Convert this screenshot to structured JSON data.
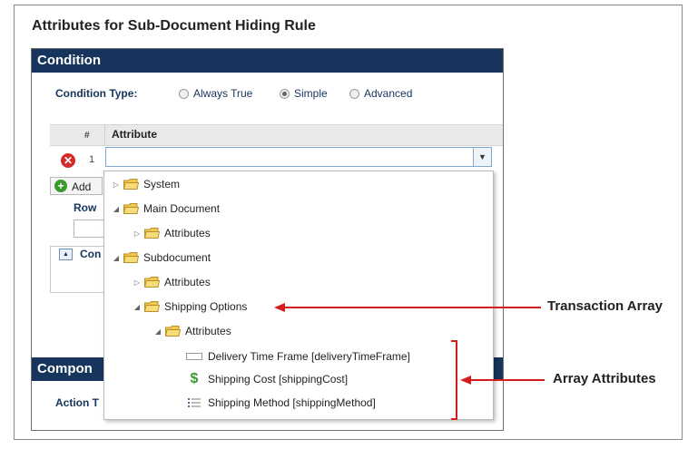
{
  "page": {
    "title": "Attributes for Sub-Document Hiding Rule"
  },
  "condition_panel": {
    "header": "Condition",
    "condition_type_label": "Condition Type:",
    "radio_options": [
      {
        "label": "Always True",
        "selected": false
      },
      {
        "label": "Simple",
        "selected": true
      },
      {
        "label": "Advanced",
        "selected": false
      }
    ],
    "grid": {
      "col_number": "#",
      "col_attribute": "Attribute",
      "row_number": "1",
      "attribute_value": ""
    },
    "add_button_label": "Add",
    "row_label": "Row",
    "collapse_label": "Con"
  },
  "component_panel": {
    "header": "Compon",
    "action_label": "Action T"
  },
  "attribute_tree": {
    "nodes": [
      {
        "label": "System",
        "expanded": false,
        "icon": "folder-icon"
      },
      {
        "label": "Main Document",
        "expanded": true,
        "icon": "folder-icon"
      },
      {
        "label": "Attributes",
        "expanded": false,
        "icon": "folder-icon"
      },
      {
        "label": "Subdocument",
        "expanded": true,
        "icon": "folder-icon"
      },
      {
        "label": "Attributes",
        "expanded": false,
        "icon": "folder-icon"
      },
      {
        "label": "Shipping Options",
        "expanded": true,
        "icon": "folder-icon"
      },
      {
        "label": "Attributes",
        "expanded": true,
        "icon": "folder-icon"
      },
      {
        "label": "Delivery Time Frame [deliveryTimeFrame]",
        "icon": "text-field-icon"
      },
      {
        "label": "Shipping Cost [shippingCost]",
        "icon": "dollar-icon"
      },
      {
        "label": "Shipping Method [shippingMethod]",
        "icon": "list-icon"
      }
    ]
  },
  "annotations": {
    "transaction_array": "Transaction Array",
    "array_attributes": "Array Attributes"
  },
  "colors": {
    "header_bg": "#16345c",
    "annotation_red": "#d71c1c",
    "folder_yellow": "#f2c94c"
  }
}
